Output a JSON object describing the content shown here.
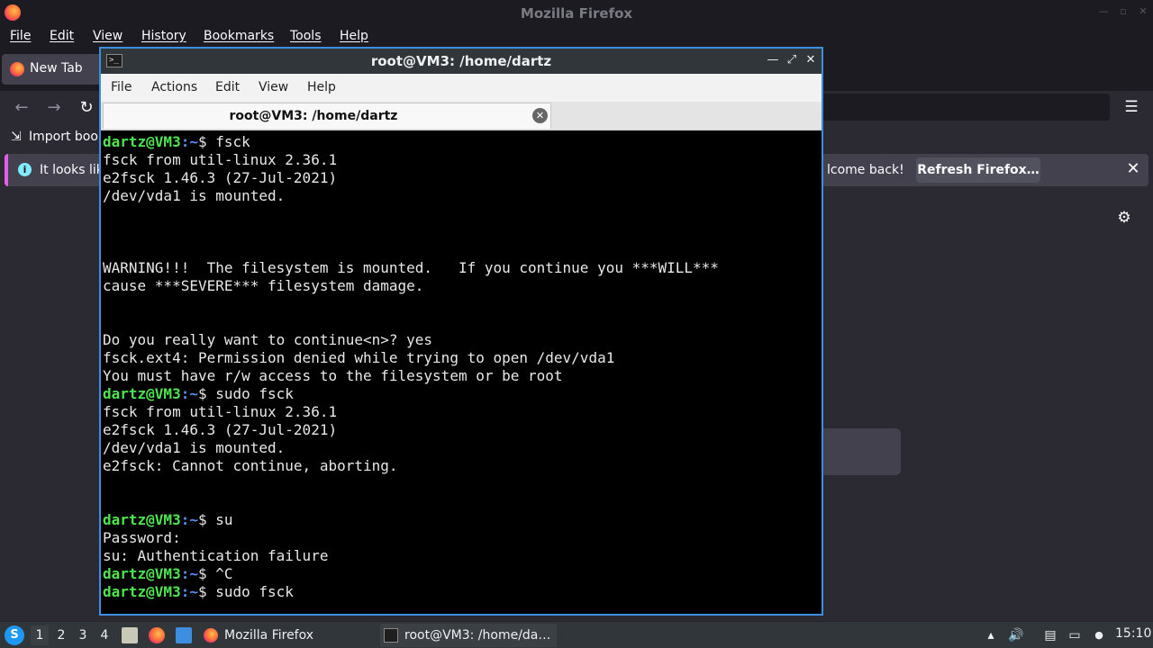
{
  "firefox": {
    "window_title": "Mozilla Firefox",
    "menu": [
      "File",
      "Edit",
      "View",
      "History",
      "Bookmarks",
      "Tools",
      "Help"
    ],
    "tab_label": "New Tab",
    "bookmarks_label": "Import book",
    "notice_left": "It looks lik",
    "notice_right": "lcome back!",
    "refresh_label": "Refresh Firefox…",
    "info_glyph": "i"
  },
  "terminal": {
    "title": "root@VM3: /home/dartz",
    "menu": [
      "File",
      "Actions",
      "Edit",
      "View",
      "Help"
    ],
    "tab_label": "root@VM3: /home/dartz",
    "prompt_user": "dartz@VM3",
    "prompt_path": ":~",
    "lines": [
      {
        "prompt": true,
        "cmd": "$ fsck"
      },
      {
        "text": "fsck from util-linux 2.36.1"
      },
      {
        "text": "e2fsck 1.46.3 (27-Jul-2021)"
      },
      {
        "text": "/dev/vda1 is mounted."
      },
      {
        "text": ""
      },
      {
        "text": ""
      },
      {
        "text": ""
      },
      {
        "text": "WARNING!!!  The filesystem is mounted.   If you continue you ***WILL***"
      },
      {
        "text": "cause ***SEVERE*** filesystem damage."
      },
      {
        "text": ""
      },
      {
        "text": ""
      },
      {
        "text": "Do you really want to continue<n>? yes"
      },
      {
        "text": "fsck.ext4: Permission denied while trying to open /dev/vda1"
      },
      {
        "text": "You must have r/w access to the filesystem or be root"
      },
      {
        "prompt": true,
        "cmd": "$ sudo fsck"
      },
      {
        "text": "fsck from util-linux 2.36.1"
      },
      {
        "text": "e2fsck 1.46.3 (27-Jul-2021)"
      },
      {
        "text": "/dev/vda1 is mounted."
      },
      {
        "text": "e2fsck: Cannot continue, aborting."
      },
      {
        "text": ""
      },
      {
        "text": ""
      },
      {
        "prompt": true,
        "cmd": "$ su"
      },
      {
        "text": "Password:"
      },
      {
        "text": "su: Authentication failure"
      },
      {
        "prompt": true,
        "cmd": "$ ^C"
      },
      {
        "prompt": true,
        "cmd": "$ sudo fsck"
      }
    ]
  },
  "taskbar": {
    "workspaces": [
      "1",
      "2",
      "3",
      "4"
    ],
    "task_firefox": "Mozilla Firefox",
    "task_terminal": "root@VM3: /home/da…",
    "clock": "15:10"
  },
  "colors": {
    "prompt_user": "#4ee44e",
    "prompt_path": "#5b8ff0",
    "terminal_border": "#3d8ee0"
  }
}
